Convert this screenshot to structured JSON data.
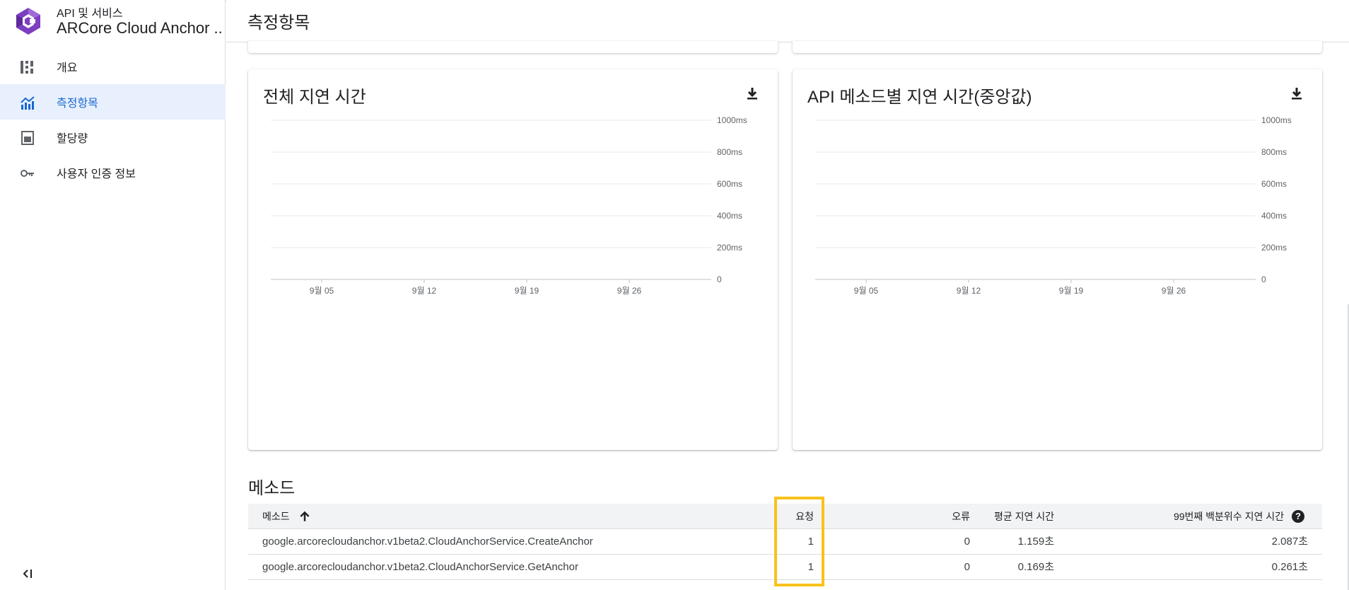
{
  "sidebar": {
    "subtitle": "API 및 서비스",
    "title": "ARCore Cloud Anchor ...",
    "items": [
      {
        "label": "개요",
        "icon": "dashboard-icon",
        "active": false
      },
      {
        "label": "측정항목",
        "icon": "chart-icon",
        "active": true
      },
      {
        "label": "할당량",
        "icon": "quota-icon",
        "active": false
      },
      {
        "label": "사용자 인증 정보",
        "icon": "key-icon",
        "active": false
      }
    ]
  },
  "header": {
    "title": "측정항목"
  },
  "colors": {
    "accent": "#1967d2",
    "active_bg": "#e8f0fe",
    "highlight": "#f9c21b"
  },
  "charts": [
    {
      "title": "전체 지연 시간",
      "chart_data": {
        "type": "line",
        "title": "전체 지연 시간",
        "x_ticks": [
          "9월 05",
          "9월 12",
          "9월 19",
          "9월 26"
        ],
        "y_ticks": [
          "1000ms",
          "800ms",
          "600ms",
          "400ms",
          "200ms",
          "0"
        ],
        "ylim": [
          0,
          1000
        ],
        "grid": true,
        "series": []
      }
    },
    {
      "title": "API 메소드별 지연 시간(중앙값)",
      "chart_data": {
        "type": "line",
        "title": "API 메소드별 지연 시간(중앙값)",
        "x_ticks": [
          "9월 05",
          "9월 12",
          "9월 19",
          "9월 26"
        ],
        "y_ticks": [
          "1000ms",
          "800ms",
          "600ms",
          "400ms",
          "200ms",
          "0"
        ],
        "ylim": [
          0,
          1000
        ],
        "grid": true,
        "series": []
      }
    }
  ],
  "methods": {
    "title": "메소드",
    "columns": {
      "method": "메소드",
      "requests": "요청",
      "errors": "오류",
      "avg_latency": "평균 지연 시간",
      "p99_latency": "99번째 백분위수 지연 시간"
    },
    "rows": [
      {
        "method": "google.arcorecloudanchor.v1beta2.CloudAnchorService.CreateAnchor",
        "requests": "1",
        "errors": "0",
        "avg_latency": "1.159초",
        "p99_latency": "2.087초"
      },
      {
        "method": "google.arcorecloudanchor.v1beta2.CloudAnchorService.GetAnchor",
        "requests": "1",
        "errors": "0",
        "avg_latency": "0.169초",
        "p99_latency": "0.261초"
      }
    ]
  }
}
